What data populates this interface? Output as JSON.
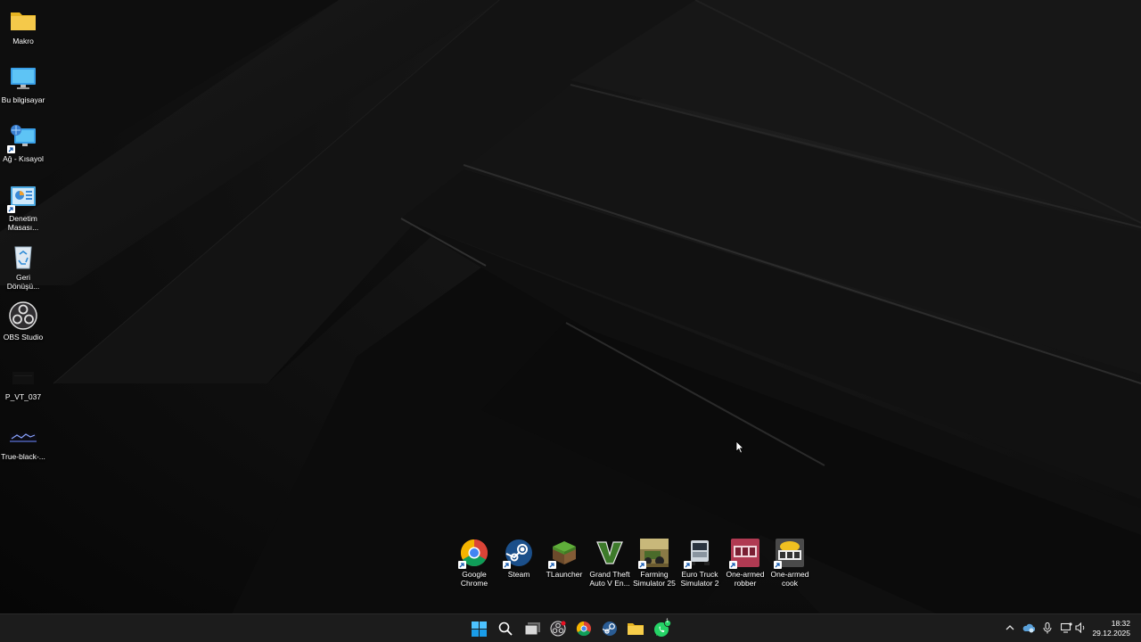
{
  "desktop_icons": [
    {
      "label": "Makro",
      "icon": "folder-icon"
    },
    {
      "label": "Bu bilgisayar",
      "icon": "this-pc-icon"
    },
    {
      "label": "Ağ - Kısayol",
      "icon": "network-icon"
    },
    {
      "label": "Denetim Masası...",
      "icon": "control-panel-icon"
    },
    {
      "label": "Geri Dönüşü...",
      "icon": "recycle-bin-icon"
    },
    {
      "label": "OBS Studio",
      "icon": "obs-icon"
    },
    {
      "label": "P_VT_037",
      "icon": "image-file-icon"
    },
    {
      "label": "True-black-...",
      "icon": "image-file-icon"
    }
  ],
  "app_shortcuts": [
    {
      "label": "Google Chrome",
      "icon": "chrome-icon"
    },
    {
      "label": "Steam",
      "icon": "steam-icon"
    },
    {
      "label": "TLauncher",
      "icon": "tlauncher-icon"
    },
    {
      "label": "Grand Theft Auto V En...",
      "icon": "gta-v-icon"
    },
    {
      "label": "Farming Simulator 25",
      "icon": "farming-simulator-icon"
    },
    {
      "label": "Euro Truck Simulator 2",
      "icon": "euro-truck-icon"
    },
    {
      "label": "One-armed robber",
      "icon": "one-armed-robber-icon"
    },
    {
      "label": "One-armed cook",
      "icon": "one-armed-cook-icon"
    }
  ],
  "taskbar": {
    "buttons": [
      "start-icon",
      "search-icon",
      "task-view-icon",
      "obs-icon",
      "chrome-icon",
      "steam-icon",
      "file-explorer-icon",
      "whatsapp-icon"
    ],
    "whatsapp_badge": "1",
    "tray": [
      "chevron-up-icon",
      "onedrive-icon",
      "microphone-icon",
      "display-icon",
      "volume-icon"
    ],
    "time": "18:32",
    "date": "29.12.2025"
  },
  "colors": {
    "taskbar_bg": "#1c1c1c",
    "accent": "#0078d4"
  }
}
